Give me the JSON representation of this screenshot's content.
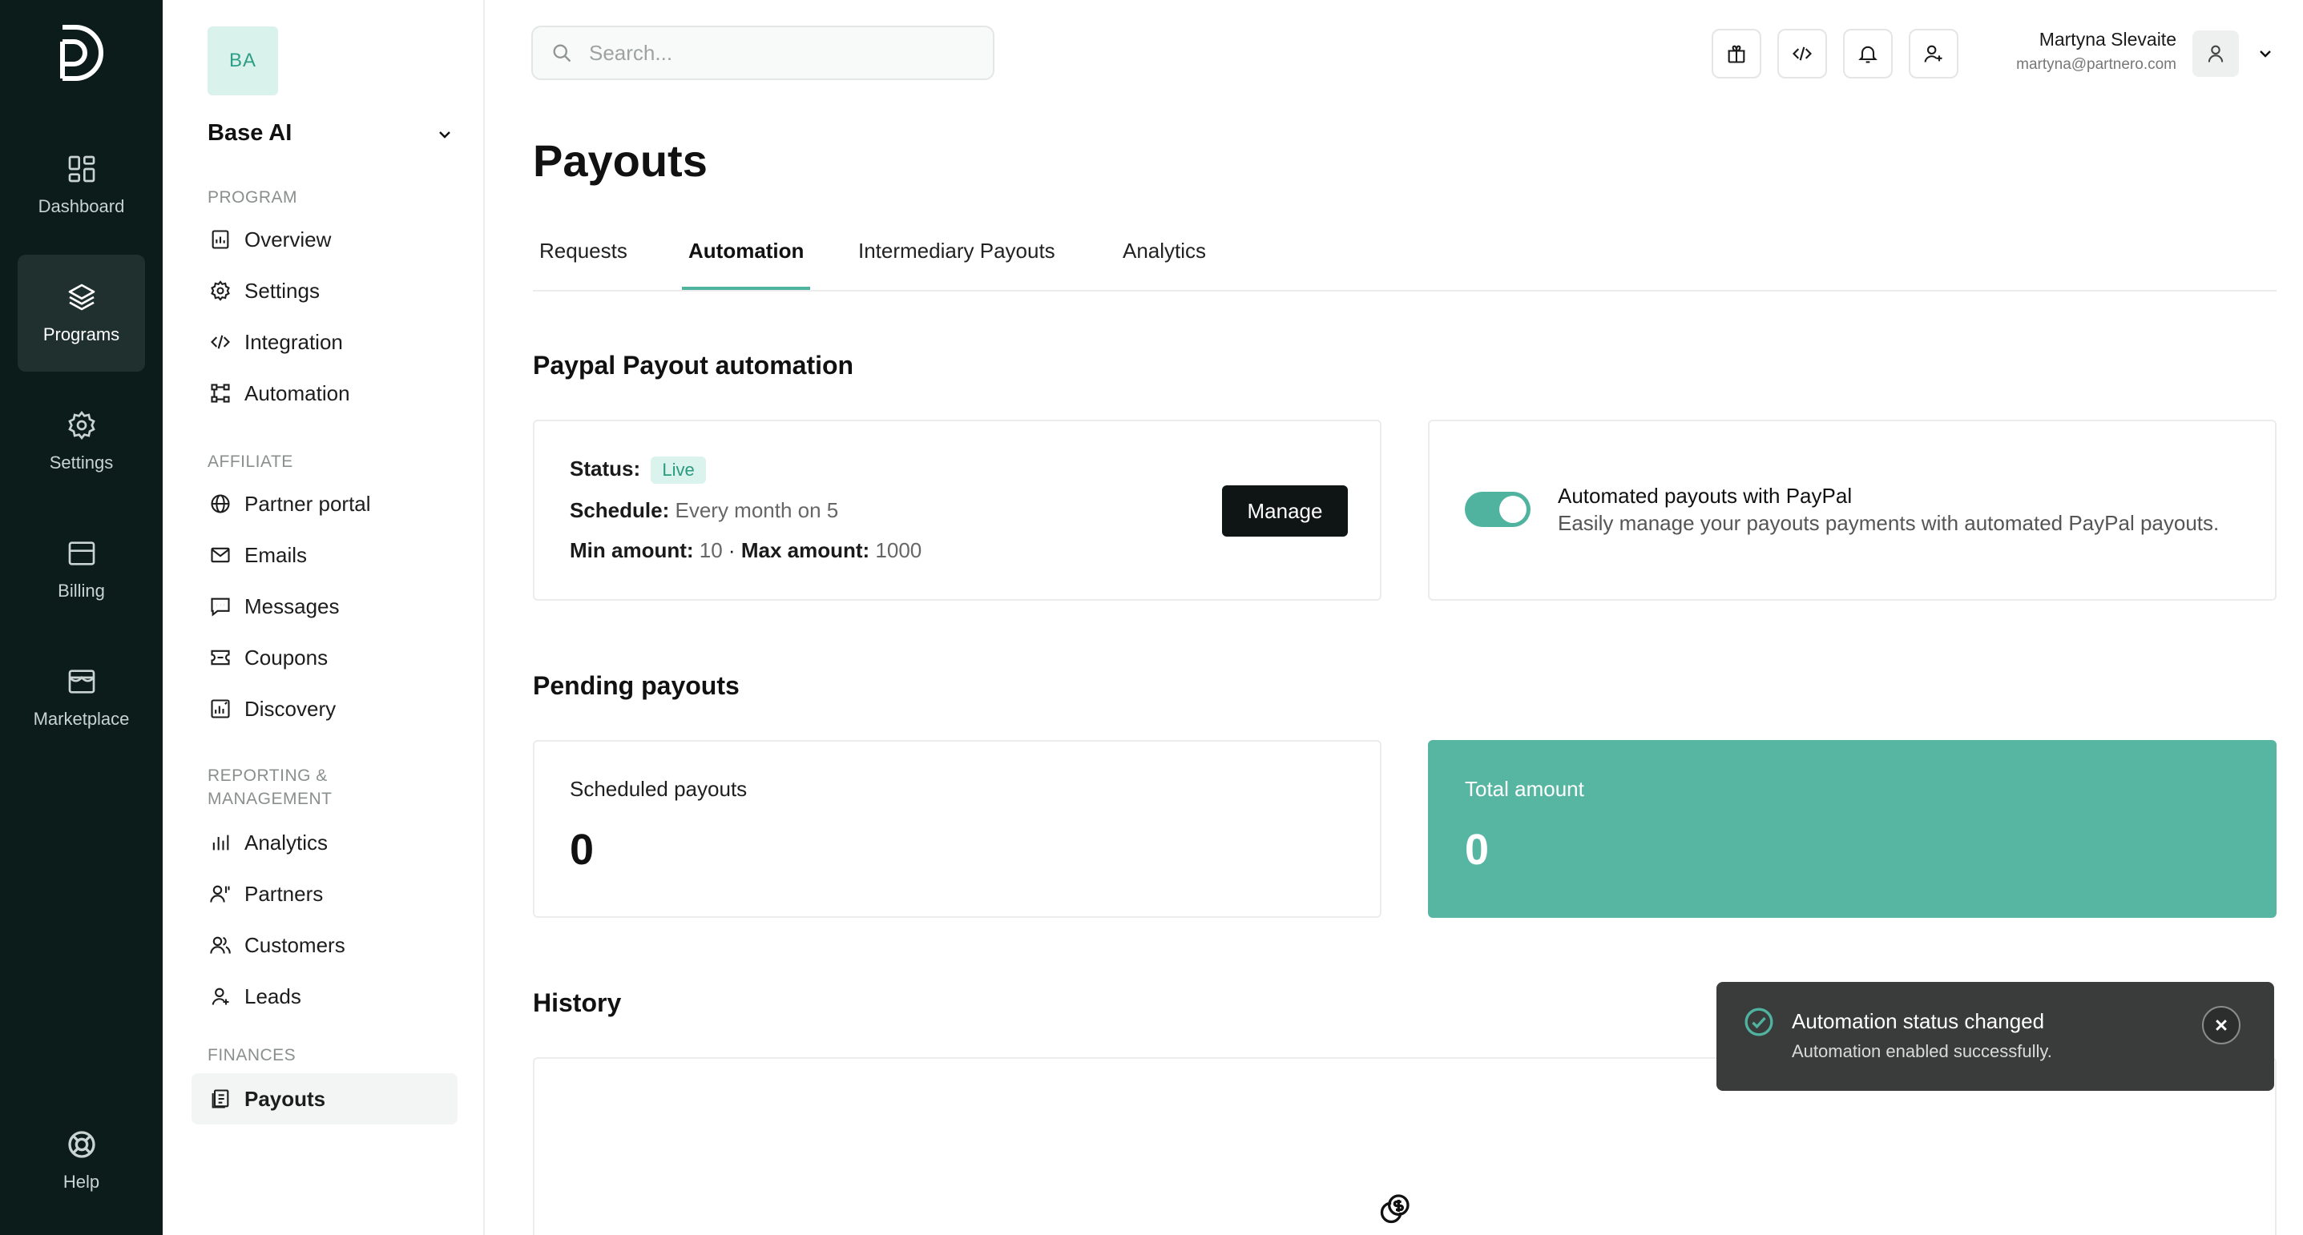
{
  "rail": {
    "items": [
      {
        "label": "Dashboard",
        "icon": "dashboard-icon"
      },
      {
        "label": "Programs",
        "icon": "layers-icon"
      },
      {
        "label": "Settings",
        "icon": "gear-icon"
      },
      {
        "label": "Billing",
        "icon": "billing-icon"
      },
      {
        "label": "Marketplace",
        "icon": "store-icon"
      }
    ],
    "help": "Help"
  },
  "sidebar": {
    "org_initials": "BA",
    "org_name": "Base AI",
    "sections": {
      "program": "PROGRAM",
      "affiliate": "AFFILIATE",
      "reporting": "REPORTING &",
      "reporting2": "MANAGEMENT",
      "finances": "FINANCES"
    },
    "items": {
      "overview": "Overview",
      "settings": "Settings",
      "integration": "Integration",
      "automation": "Automation",
      "partner_portal": "Partner portal",
      "emails": "Emails",
      "messages": "Messages",
      "coupons": "Coupons",
      "discovery": "Discovery",
      "analytics": "Analytics",
      "partners": "Partners",
      "customers": "Customers",
      "leads": "Leads",
      "payouts": "Payouts"
    }
  },
  "header": {
    "search_placeholder": "Search...",
    "user_name": "Martyna Slevaite",
    "user_email": "martyna@partnero.com"
  },
  "page": {
    "title": "Payouts",
    "tabs": [
      "Requests",
      "Automation",
      "Intermediary Payouts",
      "Analytics"
    ],
    "active_tab": "Automation"
  },
  "automation": {
    "heading": "Paypal Payout automation",
    "status_label": "Status:",
    "status_value": "Live",
    "schedule_label": "Schedule:",
    "schedule_value": "Every month on 5",
    "min_label": "Min amount:",
    "min_value": "10",
    "separator": "·",
    "max_label": "Max amount:",
    "max_value": "1000",
    "manage_label": "Manage",
    "toggle_on": true,
    "toggle_title": "Automated payouts with PayPal",
    "toggle_desc": "Easily manage your payouts payments with automated PayPal payouts."
  },
  "pending": {
    "heading": "Pending payouts",
    "scheduled_label": "Scheduled payouts",
    "scheduled_value": "0",
    "total_label": "Total amount",
    "total_value": "0"
  },
  "history": {
    "heading": "History"
  },
  "toast": {
    "title": "Automation status changed",
    "message": "Automation enabled successfully."
  },
  "colors": {
    "accent": "#57b6a2",
    "rail_bg": "#0c1c1a",
    "toast_bg": "#3a3c3c"
  }
}
